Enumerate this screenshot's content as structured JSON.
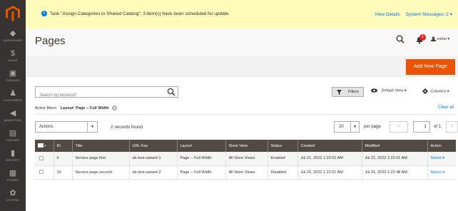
{
  "notice": {
    "icon": "info-icon",
    "message": "Task \"Assign Categories to Shared Catalog\": 3 item(s) have been scheduled for update.",
    "view_details": "View Details",
    "system_messages": "System Messages: 2 ▾"
  },
  "sidebar": {
    "items": [
      {
        "icon": "dashboard-icon",
        "label": "DASHBOARD",
        "glyph": "◆"
      },
      {
        "icon": "dollar-icon",
        "label": "SALES",
        "glyph": "$"
      },
      {
        "icon": "cube-icon",
        "label": "CATALOG",
        "glyph": "▣"
      },
      {
        "icon": "person-icon",
        "label": "CUSTOMERS",
        "glyph": "♟"
      },
      {
        "icon": "megaphone-icon",
        "label": "MARKETING",
        "glyph": "◀"
      },
      {
        "icon": "content-icon",
        "label": "CONTENT",
        "glyph": "▤"
      },
      {
        "icon": "bar-chart-icon",
        "label": "REPORTS",
        "glyph": "▮"
      },
      {
        "icon": "stores-icon",
        "label": "STORES",
        "glyph": "▦"
      },
      {
        "icon": "gear-icon",
        "label": "SYSTEM",
        "glyph": "✿"
      }
    ]
  },
  "header": {
    "title": "Pages",
    "notification_count": "1",
    "user": "eshal ▾"
  },
  "actionbar": {
    "add_new": "Add New Page"
  },
  "toolbar": {
    "search_placeholder": "Search by keyword",
    "filters": "Filters",
    "default_view": "Default View ▾",
    "columns": "Columns ▾"
  },
  "filters": {
    "label": "Active filters:",
    "value": "Layout: Page -- Full Width",
    "clear_all": "Clear all"
  },
  "grid": {
    "actions": "Actions",
    "records": "2 records found",
    "per_page_value": "20",
    "per_page_label": "per page",
    "page": "1",
    "of": "of 1",
    "prev": "<",
    "next": ">",
    "columns": [
      "ID",
      "Title",
      "URL Key",
      "Layout",
      "Store View",
      "Status",
      "Created",
      "Modified",
      "Action"
    ],
    "rows": [
      {
        "id": "9",
        "title": "Service page first",
        "url_key": "ab-test-variant-1",
        "layout": "Page -- Full Width",
        "store_view": "All Store Views",
        "status": "Enabled",
        "created": "Jul 21, 2022 1:22:01 AM",
        "modified": "Jul 21, 2022 1:22:01 AM",
        "action": "Select ▾"
      },
      {
        "id": "10",
        "title": "Service page second",
        "url_key": "ab-test-variant-2",
        "layout": "Page -- Full Width",
        "store_view": "All Store Views",
        "status": "Disabled",
        "created": "Jul 21, 2022 1:22:01 AM",
        "modified": "Jul 21, 2022 1:22:48 AM",
        "action": "Select ▾"
      }
    ]
  },
  "colors": {
    "sidebar": "#373330",
    "accent": "#eb5202",
    "link": "#007bdb",
    "table_header": "#514943",
    "notice": "#fffbbb"
  }
}
